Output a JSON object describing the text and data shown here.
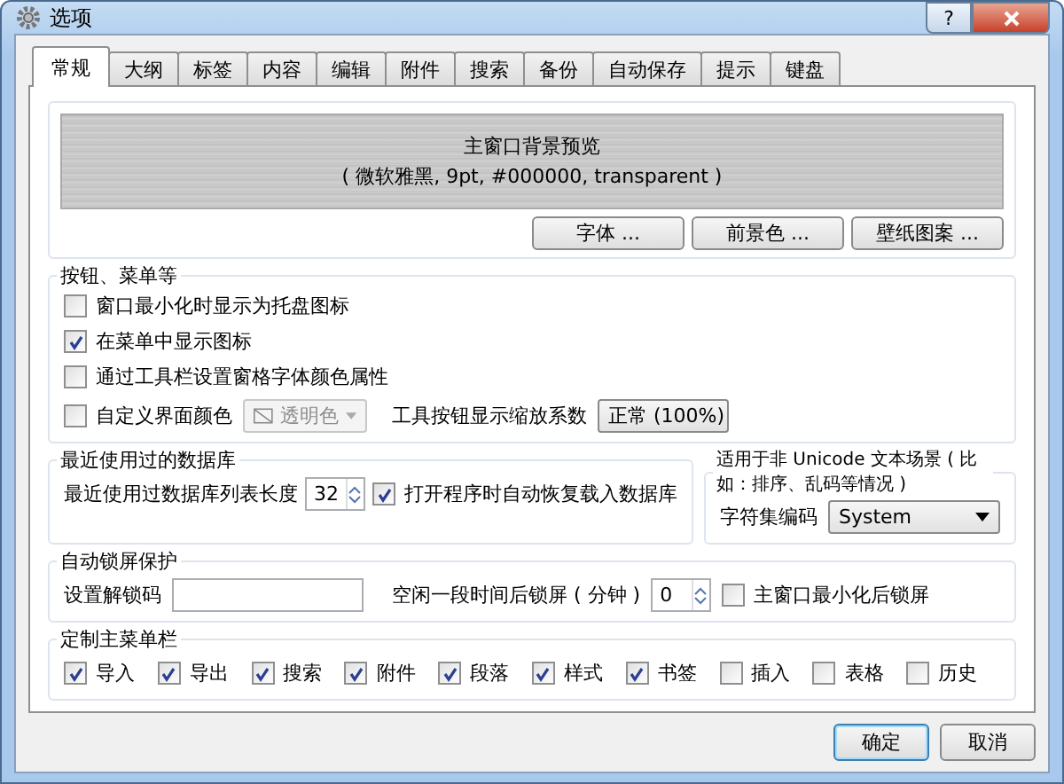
{
  "window": {
    "title": "选项",
    "help": "?"
  },
  "tabs": [
    {
      "label": "常规",
      "selected": true
    },
    {
      "label": "大纲",
      "selected": false
    },
    {
      "label": "标签",
      "selected": false
    },
    {
      "label": "内容",
      "selected": false
    },
    {
      "label": "编辑",
      "selected": false
    },
    {
      "label": "附件",
      "selected": false
    },
    {
      "label": "搜索",
      "selected": false
    },
    {
      "label": "备份",
      "selected": false
    },
    {
      "label": "自动保存",
      "selected": false
    },
    {
      "label": "提示",
      "selected": false
    },
    {
      "label": "键盘",
      "selected": false
    }
  ],
  "preview": {
    "title": "主窗口背景预览",
    "subtitle": "( 微软雅黑, 9pt, #000000, transparent )",
    "buttons": [
      "字体 ...",
      "前景色 ...",
      "壁纸图案 ..."
    ]
  },
  "buttons_menus": {
    "title": "按钮、菜单等",
    "checkboxes": [
      {
        "label": "窗口最小化时显示为托盘图标",
        "checked": false
      },
      {
        "label": "在菜单中显示图标",
        "checked": true
      },
      {
        "label": "通过工具栏设置窗格字体颜色属性",
        "checked": false
      }
    ],
    "custom_color": {
      "label": "自定义界面颜色",
      "checked": false,
      "value": "透明色",
      "disabled": true
    },
    "scale": {
      "label": "工具按钮显示缩放系数",
      "value": "正常 (100%)"
    }
  },
  "recent": {
    "title": "最近使用过的数据库",
    "length_label": "最近使用过数据库列表长度",
    "length_value": "32",
    "restore": {
      "label": "打开程序时自动恢复载入数据库",
      "checked": true
    }
  },
  "encoding": {
    "title": "适用于非 Unicode 文本场景 ( 比如：排序、乱码等情况 )",
    "label": "字符集编码",
    "value": "System"
  },
  "lock": {
    "title": "自动锁屏保护",
    "password_label": "设置解锁码",
    "idle_label": "空闲一段时间后锁屏 ( 分钟 )",
    "idle_value": "0",
    "minimize": {
      "label": "主窗口最小化后锁屏",
      "checked": false
    }
  },
  "main_menu": {
    "title": "定制主菜单栏",
    "items": [
      {
        "label": "导入",
        "checked": true
      },
      {
        "label": "导出",
        "checked": true
      },
      {
        "label": "搜索",
        "checked": true
      },
      {
        "label": "附件",
        "checked": true
      },
      {
        "label": "段落",
        "checked": true
      },
      {
        "label": "样式",
        "checked": true
      },
      {
        "label": "书签",
        "checked": true
      },
      {
        "label": "插入",
        "checked": false
      },
      {
        "label": "表格",
        "checked": false
      },
      {
        "label": "历史",
        "checked": false
      }
    ]
  },
  "dialog_buttons": [
    {
      "label": "确定",
      "default": true
    },
    {
      "label": "取消",
      "default": false
    }
  ]
}
